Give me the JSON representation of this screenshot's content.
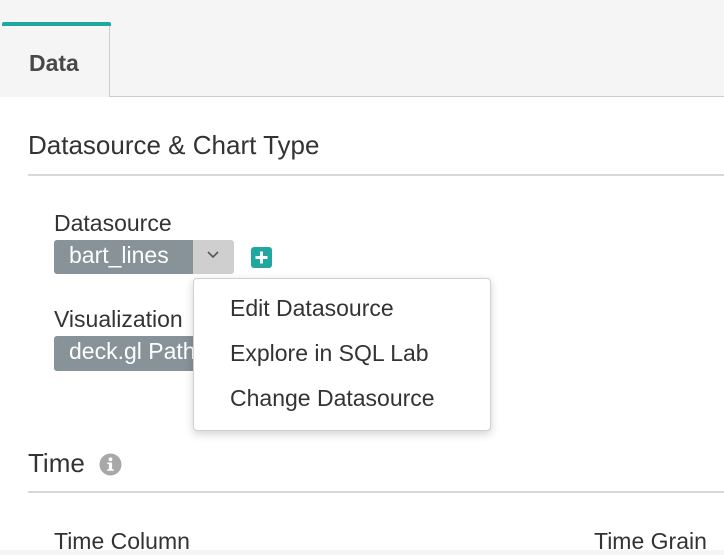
{
  "tabs": [
    {
      "label": "Data",
      "active": true
    }
  ],
  "colors": {
    "accent": "#20a7a0",
    "pill": "#879399",
    "caret_bg": "#cfcfcf",
    "info_icon": "#a8a8a8"
  },
  "sections": {
    "datasource": {
      "title": "Datasource & Chart Type",
      "datasource_label": "Datasource",
      "datasource_value": "bart_lines",
      "visualization_label": "Visualization",
      "visualization_value": "deck.gl Path"
    },
    "time": {
      "title": "Time",
      "time_column_label": "Time Column",
      "time_grain_label": "Time Grain"
    }
  },
  "dropdown_menu": {
    "items": [
      {
        "label": "Edit Datasource"
      },
      {
        "label": "Explore in SQL Lab"
      },
      {
        "label": "Change Datasource"
      }
    ]
  },
  "icons": {
    "caret": "chevron-down-icon",
    "add": "plus-icon",
    "info": "info-icon"
  }
}
